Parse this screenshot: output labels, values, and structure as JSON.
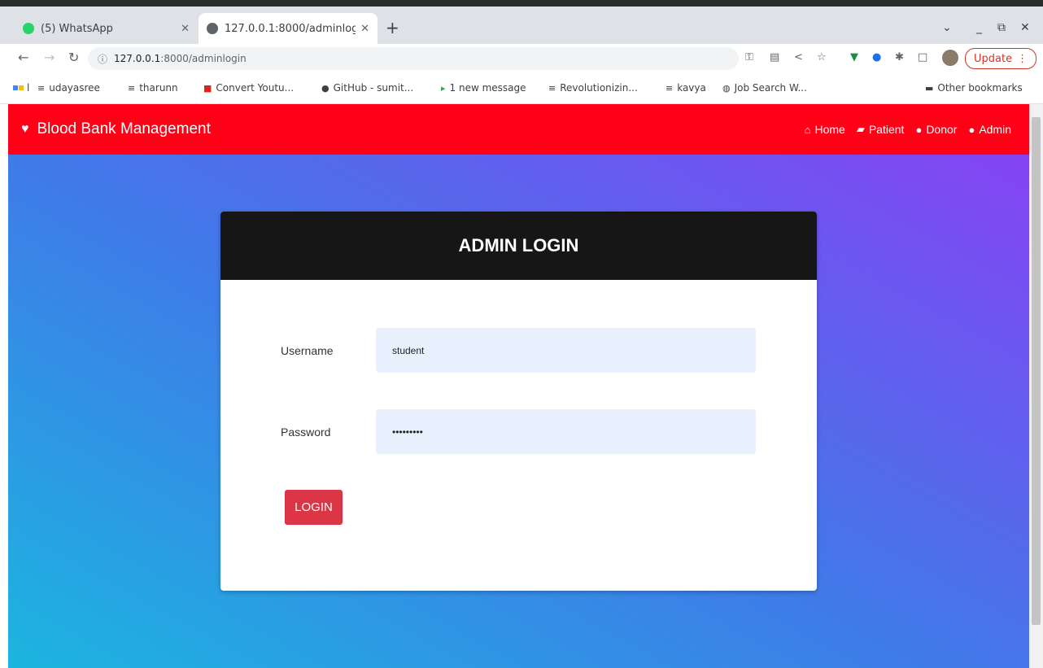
{
  "browser": {
    "tabs": [
      {
        "title": "(5) WhatsApp",
        "active": false
      },
      {
        "title": "127.0.0.1:8000/adminlogi",
        "active": true
      }
    ],
    "new_tab": "+",
    "window_controls": {
      "dropdown": "⌄",
      "minimize": "_",
      "restore": "⧉",
      "close": "✕"
    },
    "url": {
      "host": "127.0.0.1",
      "path": ":8000/adminlogin"
    },
    "update_label": "Update",
    "bookmarks": [
      {
        "icon": "list-icon",
        "label": "udayasree"
      },
      {
        "icon": "list-icon",
        "label": "tharunn"
      },
      {
        "icon": "youtube-icon",
        "label": "Convert Youtu..."
      },
      {
        "icon": "github-icon",
        "label": "GitHub - sumit..."
      },
      {
        "icon": "mail-icon",
        "label": "1 new message"
      },
      {
        "icon": "list-icon",
        "label": "Revolutionizin..."
      },
      {
        "icon": "list-icon",
        "label": "kavya"
      },
      {
        "icon": "globe-icon",
        "label": "Job Search W..."
      }
    ],
    "bookmarks_first": "l",
    "other_bookmarks": "Other bookmarks"
  },
  "app": {
    "brand": "Blood Bank Management",
    "nav": [
      {
        "icon": "home-icon",
        "label": "Home"
      },
      {
        "icon": "bed-icon",
        "label": "Patient"
      },
      {
        "icon": "user-icon",
        "label": "Donor"
      },
      {
        "icon": "user-cog-icon",
        "label": "Admin"
      }
    ],
    "colors": {
      "navbar": "#ff0016",
      "card_header": "#161616",
      "button": "#dc3545",
      "input_bg": "#e8f0fe"
    }
  },
  "login": {
    "heading": "ADMIN LOGIN",
    "username_label": "Username",
    "username_value": "student",
    "password_label": "Password",
    "password_value": "studentpw",
    "button": "LOGIN"
  }
}
